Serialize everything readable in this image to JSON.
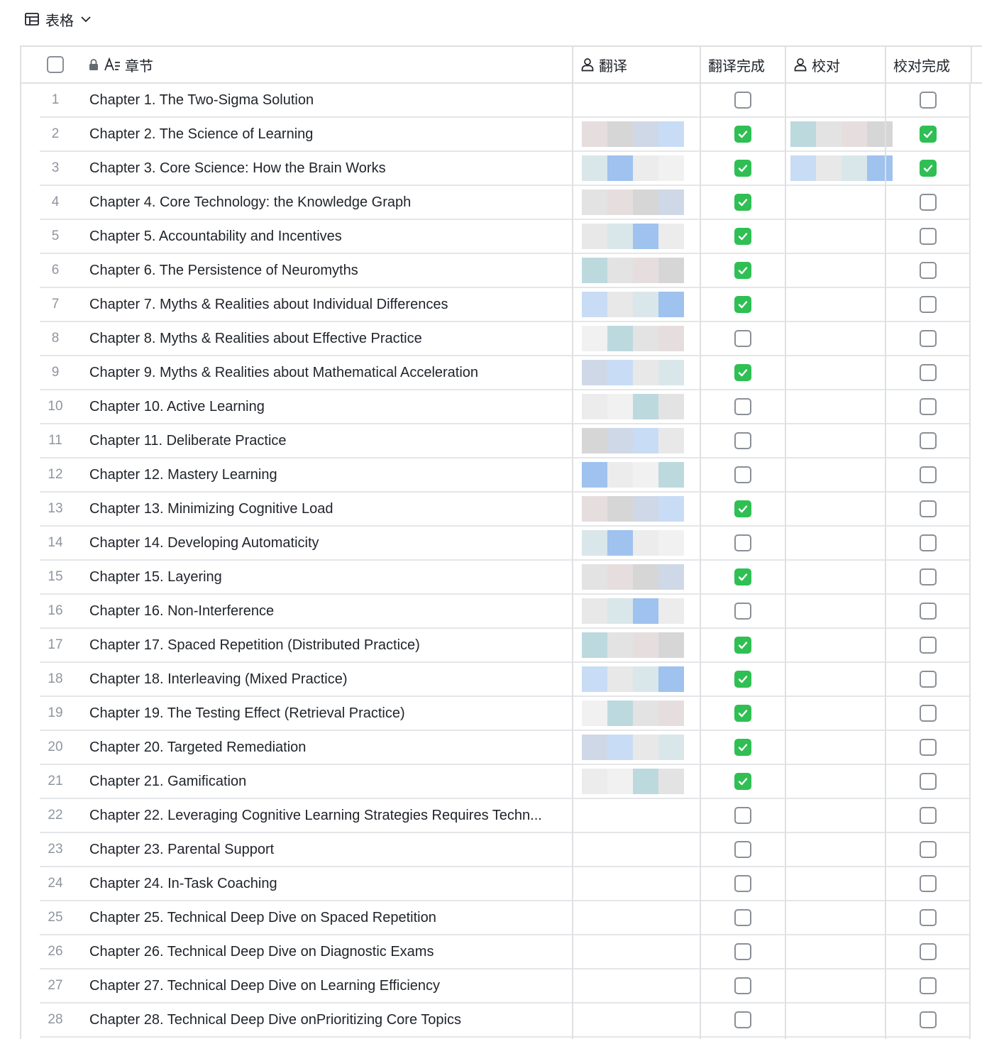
{
  "toolbar": {
    "view_label": "表格",
    "view_icon": "table-icon",
    "dropdown_icon": "chevron-down-icon"
  },
  "columns": {
    "chapter": "章节",
    "translator": "翻译",
    "translation_done": "翻译完成",
    "proofreader": "校对",
    "proofread_done": "校对完成"
  },
  "rows": [
    {
      "n": "1",
      "chapter": "Chapter 1. The Two-Sigma Solution",
      "t_done": false,
      "p_done": false,
      "t_person": false,
      "p_person": false
    },
    {
      "n": "2",
      "chapter": "Chapter 2. The Science of Learning",
      "t_done": true,
      "p_done": true,
      "t_person": true,
      "p_person": true
    },
    {
      "n": "3",
      "chapter": "Chapter 3. Core Science: How the Brain Works",
      "t_done": true,
      "p_done": true,
      "t_person": true,
      "p_person": true
    },
    {
      "n": "4",
      "chapter": "Chapter 4. Core Technology: the Knowledge Graph",
      "t_done": true,
      "p_done": false,
      "t_person": true,
      "p_person": false
    },
    {
      "n": "5",
      "chapter": "Chapter 5. Accountability and Incentives",
      "t_done": true,
      "p_done": false,
      "t_person": true,
      "p_person": false
    },
    {
      "n": "6",
      "chapter": "Chapter 6. The Persistence of Neuromyths",
      "t_done": true,
      "p_done": false,
      "t_person": true,
      "p_person": false
    },
    {
      "n": "7",
      "chapter": "Chapter 7. Myths & Realities about Individual Differences",
      "t_done": true,
      "p_done": false,
      "t_person": true,
      "p_person": false
    },
    {
      "n": "8",
      "chapter": "Chapter 8. Myths & Realities about Effective Practice",
      "t_done": false,
      "p_done": false,
      "t_person": true,
      "p_person": false
    },
    {
      "n": "9",
      "chapter": "Chapter 9. Myths & Realities about Mathematical Acceleration",
      "t_done": true,
      "p_done": false,
      "t_person": true,
      "p_person": false
    },
    {
      "n": "10",
      "chapter": "Chapter 10. Active Learning",
      "t_done": false,
      "p_done": false,
      "t_person": true,
      "p_person": false
    },
    {
      "n": "11",
      "chapter": "Chapter 11. Deliberate Practice",
      "t_done": false,
      "p_done": false,
      "t_person": true,
      "p_person": false
    },
    {
      "n": "12",
      "chapter": "Chapter 12. Mastery Learning",
      "t_done": false,
      "p_done": false,
      "t_person": true,
      "p_person": false
    },
    {
      "n": "13",
      "chapter": "Chapter 13. Minimizing Cognitive Load",
      "t_done": true,
      "p_done": false,
      "t_person": true,
      "p_person": false
    },
    {
      "n": "14",
      "chapter": "Chapter 14. Developing Automaticity",
      "t_done": false,
      "p_done": false,
      "t_person": true,
      "p_person": false
    },
    {
      "n": "15",
      "chapter": "Chapter 15. Layering",
      "t_done": true,
      "p_done": false,
      "t_person": true,
      "p_person": false
    },
    {
      "n": "16",
      "chapter": "Chapter 16. Non-Interference",
      "t_done": false,
      "p_done": false,
      "t_person": true,
      "p_person": false
    },
    {
      "n": "17",
      "chapter": "Chapter 17. Spaced Repetition (Distributed Practice)",
      "t_done": true,
      "p_done": false,
      "t_person": true,
      "p_person": false
    },
    {
      "n": "18",
      "chapter": "Chapter 18. Interleaving (Mixed Practice)",
      "t_done": true,
      "p_done": false,
      "t_person": true,
      "p_person": false
    },
    {
      "n": "19",
      "chapter": "Chapter 19. The Testing Effect (Retrieval Practice)",
      "t_done": true,
      "p_done": false,
      "t_person": true,
      "p_person": false
    },
    {
      "n": "20",
      "chapter": "Chapter 20. Targeted Remediation",
      "t_done": true,
      "p_done": false,
      "t_person": true,
      "p_person": false
    },
    {
      "n": "21",
      "chapter": "Chapter 21. Gamification",
      "t_done": true,
      "p_done": false,
      "t_person": true,
      "p_person": false
    },
    {
      "n": "22",
      "chapter": "Chapter 22. Leveraging Cognitive Learning Strategies Requires Techn...",
      "t_done": false,
      "p_done": false,
      "t_person": false,
      "p_person": false
    },
    {
      "n": "23",
      "chapter": "Chapter 23. Parental Support",
      "t_done": false,
      "p_done": false,
      "t_person": false,
      "p_person": false
    },
    {
      "n": "24",
      "chapter": "Chapter 24. In-Task Coaching",
      "t_done": false,
      "p_done": false,
      "t_person": false,
      "p_person": false
    },
    {
      "n": "25",
      "chapter": "Chapter 25. Technical Deep Dive on Spaced Repetition",
      "t_done": false,
      "p_done": false,
      "t_person": false,
      "p_person": false
    },
    {
      "n": "26",
      "chapter": "Chapter 26. Technical Deep Dive on Diagnostic Exams",
      "t_done": false,
      "p_done": false,
      "t_person": false,
      "p_person": false
    },
    {
      "n": "27",
      "chapter": "Chapter 27. Technical Deep Dive on Learning Efficiency",
      "t_done": false,
      "p_done": false,
      "t_person": false,
      "p_person": false
    },
    {
      "n": "28",
      "chapter": "Chapter 28. Technical Deep Dive onPrioritizing Core Topics",
      "t_done": false,
      "p_done": false,
      "t_person": false,
      "p_person": false
    }
  ],
  "colors": {
    "checked": "#2fbf53",
    "border": "#dee0e3",
    "row_number": "#8f959e"
  }
}
